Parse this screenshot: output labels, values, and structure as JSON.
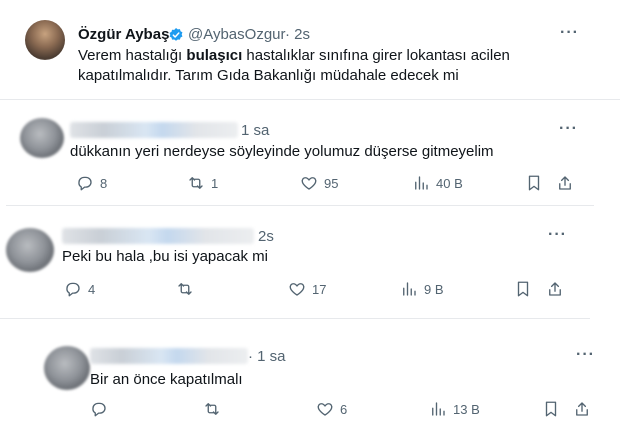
{
  "main_tweet": {
    "name": "Özgür Aybaş",
    "handle": "@AybasOzgur",
    "time": "· 2s",
    "text_before": "Verem hastalığı ",
    "text_bold": "bulaşıcı",
    "text_after": " hastalıklar sınıfına girer lokantası acilen kapatılmalıdır. Tarım Gıda Bakanlığı müdahale edecek mi"
  },
  "replies": [
    {
      "time": "1 sa",
      "text": "dükkanın yeri nerdeyse söyleyinde yolumuz düşerse gitmeyelim",
      "reply_count": "8",
      "retweet_count": "1",
      "like_count": "95",
      "view_count": "40 B"
    },
    {
      "time": "2s",
      "text": "Peki bu hala ,bu isi yapacak mi",
      "reply_count": "4",
      "retweet_count": "",
      "like_count": "17",
      "view_count": "9 B"
    },
    {
      "time": "· 1 sa",
      "text": "Bir an önce kapatılmalı",
      "reply_count": "",
      "retweet_count": "",
      "like_count": "6",
      "view_count": "13 B"
    }
  ],
  "icons": {
    "more": "more-icon",
    "reply": "reply-icon",
    "retweet": "retweet-icon",
    "like": "heart-icon",
    "views": "views-icon",
    "bookmark": "bookmark-icon",
    "share": "share-icon",
    "verified": "verified-badge-icon"
  },
  "colors": {
    "verified": "#1d9bf0",
    "secondary_text": "#536471",
    "primary_text": "#0f1419"
  }
}
